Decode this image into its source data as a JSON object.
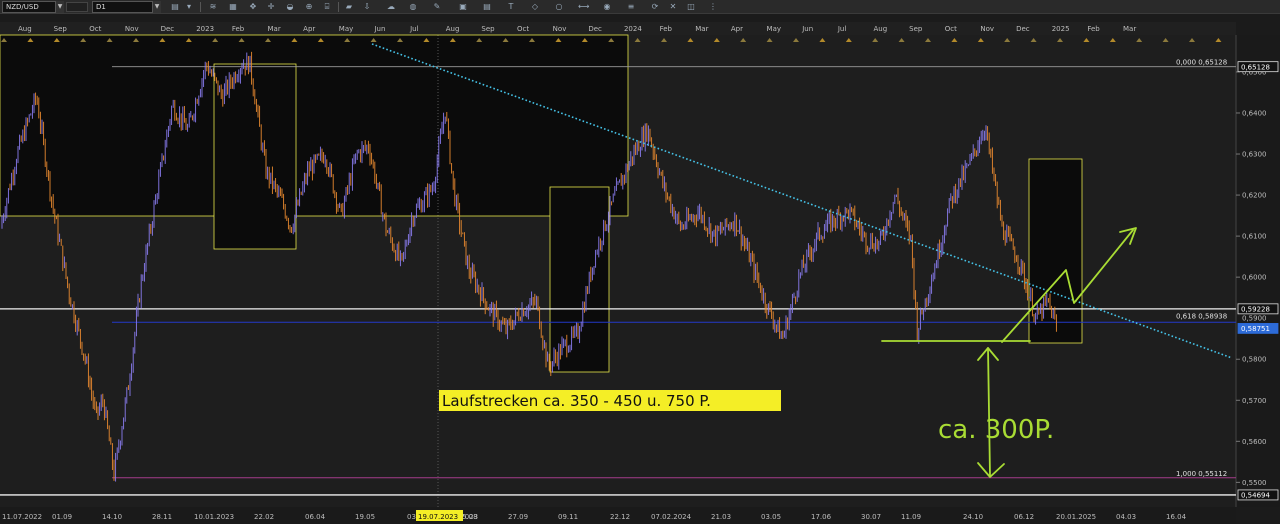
{
  "toolbar": {
    "symbol": "NZD/USD",
    "timeframe": "D1"
  },
  "colors": {
    "background": "#1b1b1b",
    "plot_background": "#1e1e1e",
    "shaded_region": "#0b0b0b",
    "candle_up": "#8a7cf0",
    "candle_down": "#e8892f",
    "trendline": "#45c3e8",
    "yellow": "#e7e64a",
    "hand_drawn": "#a9dc34",
    "current_price_badge": "#2d6bd8",
    "blue_line": "#2338c8",
    "magenta_line": "#a33b8a"
  },
  "chart_data": {
    "type": "line",
    "title": "",
    "xlabel": "",
    "ylabel": "",
    "ylim": [
      0.544,
      0.659
    ],
    "xlim": [
      "2022-07-11",
      "2025-04-25"
    ],
    "grid": false,
    "series": [
      {
        "x": [
          "2022-07-11",
          "2022-07-25",
          "2022-08-10",
          "2022-08-23",
          "2022-09-06",
          "2022-09-20",
          "2022-09-28",
          "2022-10-04",
          "2022-10-13",
          "2022-10-25",
          "2022-11-04",
          "2022-11-18",
          "2022-11-30",
          "2022-12-13",
          "2022-12-28",
          "2023-01-10",
          "2023-01-26",
          "2023-02-02",
          "2023-02-15",
          "2023-03-01",
          "2023-03-08",
          "2023-03-22",
          "2023-04-05",
          "2023-04-18",
          "2023-05-01",
          "2023-05-11",
          "2023-05-25",
          "2023-06-07",
          "2023-06-16",
          "2023-07-03",
          "2023-07-13",
          "2023-07-20",
          "2023-08-01",
          "2023-08-17",
          "2023-09-01",
          "2023-09-14",
          "2023-09-26",
          "2023-10-06",
          "2023-10-18",
          "2023-10-30",
          "2023-11-13",
          "2023-11-30",
          "2023-12-15",
          "2023-12-27",
          "2024-01-09",
          "2024-01-23",
          "2024-02-07",
          "2024-02-20",
          "2024-03-08",
          "2024-03-21",
          "2024-04-02",
          "2024-04-16",
          "2024-05-01",
          "2024-05-15",
          "2024-05-28",
          "2024-06-10",
          "2024-06-24",
          "2024-07-05",
          "2024-07-18",
          "2024-07-31",
          "2024-08-05",
          "2024-08-20",
          "2024-09-02",
          "2024-09-18",
          "2024-09-30",
          "2024-10-14",
          "2024-10-28",
          "2024-11-11",
          "2024-11-21",
          "2024-11-29"
        ],
        "values": [
          0.612,
          0.63,
          0.644,
          0.618,
          0.596,
          0.579,
          0.566,
          0.57,
          0.552,
          0.574,
          0.598,
          0.622,
          0.642,
          0.636,
          0.652,
          0.644,
          0.652,
          0.652,
          0.626,
          0.618,
          0.612,
          0.626,
          0.63,
          0.615,
          0.63,
          0.632,
          0.612,
          0.603,
          0.615,
          0.622,
          0.641,
          0.621,
          0.602,
          0.593,
          0.587,
          0.592,
          0.594,
          0.578,
          0.583,
          0.586,
          0.605,
          0.62,
          0.63,
          0.636,
          0.622,
          0.612,
          0.616,
          0.61,
          0.614,
          0.604,
          0.594,
          0.585,
          0.601,
          0.61,
          0.614,
          0.616,
          0.609,
          0.608,
          0.62,
          0.609,
          0.587,
          0.603,
          0.619,
          0.628,
          0.637,
          0.612,
          0.604,
          0.59,
          0.594,
          0.587
        ]
      }
    ],
    "x_tick_labels_top": [
      "Aug",
      "Sep",
      "Oct",
      "Nov",
      "Dec",
      "2023",
      "Feb",
      "Mar",
      "Apr",
      "May",
      "Jun",
      "Jul",
      "Aug",
      "Sep",
      "Oct",
      "Nov",
      "Dec",
      "2024",
      "Feb",
      "Mar",
      "Apr",
      "May",
      "Jun",
      "Jul",
      "Aug",
      "Sep",
      "Oct",
      "Nov",
      "Dec",
      "2025",
      "Feb",
      "Mar"
    ],
    "x_tick_labels_bottom": [
      "11.07.2022",
      "01.09",
      "14.10",
      "28.11",
      "10.01.2023",
      "22.02",
      "06.04",
      "19.05",
      "03",
      "19.07.2023",
      "5.08",
      "27.09",
      "09.11",
      "22.12",
      "07.02.2024",
      "21.03",
      "03.05",
      "17.06",
      "30.07",
      "11.09",
      "24.10",
      "06.12",
      "20.01.2025",
      "04.03",
      "16.04"
    ],
    "y_tick_labels": [
      "0,6500",
      "0,6400",
      "0,6300",
      "0,6200",
      "0,6100",
      "0,6000",
      "0,5800",
      "0,5700",
      "0,5600",
      "0,5500"
    ],
    "y_ticks": [
      0.65,
      0.64,
      0.63,
      0.62,
      0.61,
      0.6,
      0.58,
      0.57,
      0.56,
      0.55
    ],
    "price_badges": [
      {
        "label": "0,65128",
        "value": 0.65128,
        "style": "outline"
      },
      {
        "label": "0,59228",
        "value": 0.59228,
        "style": "outline"
      },
      {
        "label": "0,5900",
        "value": 0.59,
        "style": "tick"
      },
      {
        "label": "0,58751",
        "value": 0.58751,
        "style": "current"
      },
      {
        "label": "0,54694",
        "value": 0.54694,
        "style": "outline"
      }
    ],
    "fibonacci_levels": [
      {
        "label": "0,000 0,65128",
        "value": 0.65128
      },
      {
        "label": "0,618 0,58938",
        "value": 0.58938
      },
      {
        "label": "1,000 0,55112",
        "value": 0.55112
      }
    ],
    "horizontal_lines": [
      {
        "value": 0.59228,
        "color": "white"
      },
      {
        "value": 0.54694,
        "color": "white"
      },
      {
        "value": 0.589,
        "color": "blue"
      }
    ],
    "annotations": {
      "yellow_label": "Laufstrecken ca. 350 - 450 u. 750 P.",
      "handwritten": "ca. 300P.",
      "highlighted_date": "19.07.2023"
    }
  }
}
